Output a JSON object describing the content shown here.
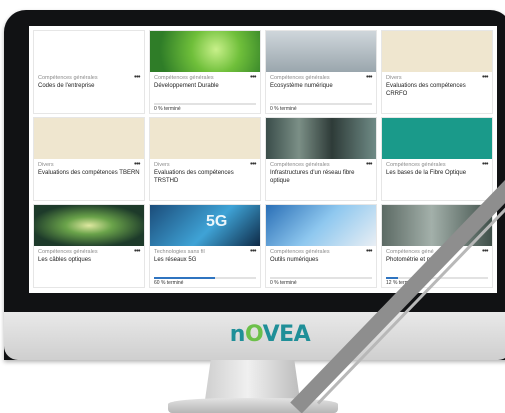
{
  "brand": {
    "name_prefix": "n",
    "name_o": "O",
    "name_suffix": "VEA"
  },
  "courses": [
    {
      "category": "Compétences générales",
      "title": "Codes de l'entreprise",
      "progress_label": "",
      "progress": null,
      "thumb": "t-city",
      "icon": "city-illustration-icon"
    },
    {
      "category": "Compétences générales",
      "title": "Développement Durable",
      "progress_label": "0 % terminé",
      "progress": 0,
      "thumb": "t-green",
      "icon": "eco-globe-icon"
    },
    {
      "category": "Compétences générales",
      "title": "Ecosystème numérique",
      "progress_label": "0 % terminé",
      "progress": 0,
      "thumb": "t-cloud",
      "icon": "cloud-network-icon"
    },
    {
      "category": "Divers",
      "title": "Evaluations des compétences CRRFO",
      "progress_label": "",
      "progress": null,
      "thumb": "t-hands",
      "icon": "raised-hands-icon"
    },
    {
      "category": "Divers",
      "title": "Evaluations des compétences TBERN",
      "progress_label": "",
      "progress": null,
      "thumb": "t-hands",
      "icon": "raised-hands-icon"
    },
    {
      "category": "Divers",
      "title": "Evaluations des compétences TRSTHD",
      "progress_label": "",
      "progress": null,
      "thumb": "t-hands",
      "icon": "raised-hands-icon"
    },
    {
      "category": "Compétences générales",
      "title": "Infrastructures d'un réseau fibre optique",
      "progress_label": "",
      "progress": null,
      "thumb": "t-rack",
      "icon": "server-rack-icon"
    },
    {
      "category": "Compétences générales",
      "title": "Les bases de la Fibre Optique",
      "progress_label": "",
      "progress": null,
      "thumb": "t-teal",
      "icon": "fiber-strands-icon"
    },
    {
      "category": "Compétences générales",
      "title": "Les câbles optiques",
      "progress_label": "",
      "progress": null,
      "thumb": "t-fiber",
      "icon": "fiber-cable-icon"
    },
    {
      "category": "Technologies sans fil",
      "title": "Les réseaux 5G",
      "progress_label": "60 % terminé",
      "progress": 60,
      "thumb": "t-5g",
      "icon": "5g-icon"
    },
    {
      "category": "Compétences générales",
      "title": "Outils numériques",
      "progress_label": "0 % terminé",
      "progress": 0,
      "thumb": "t-tablet",
      "icon": "tablet-apps-icon"
    },
    {
      "category": "Compétences géné",
      "title": "Photométrie et p",
      "progress_label": "12 % terminé",
      "progress": 12,
      "thumb": "t-device",
      "icon": "measurement-device-icon"
    }
  ],
  "thumb_texts": {
    "five_g": "5G"
  },
  "menu_glyph": "•••",
  "colors": {
    "progress": "#2f74c0",
    "brand_teal": "#1f8f98",
    "brand_green": "#6cc04a"
  }
}
